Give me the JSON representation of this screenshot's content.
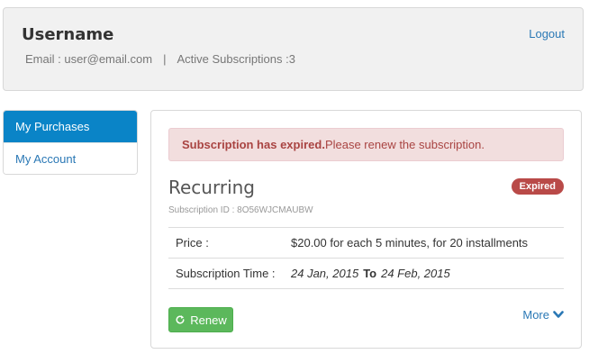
{
  "header": {
    "username": "Username",
    "email_text": "Email : user@email.com",
    "separator": "|",
    "active_subscriptions_text": "Active Subscriptions :3",
    "logout_label": "Logout"
  },
  "sidebar": {
    "items": [
      {
        "label": "My Purchases",
        "active": true
      },
      {
        "label": "My Account",
        "active": false
      }
    ]
  },
  "subscription": {
    "alert_strong": "Subscription has expired.",
    "alert_text": "Please renew the subscription.",
    "title": "Recurring",
    "status_badge": "Expired",
    "id_text": "Subscription ID : 8O56WJCMAUBW",
    "price_label": "Price :",
    "price_value": "$20.00 for each 5 minutes, for 20 installments",
    "time_label": "Subscription Time :",
    "start_date": "24 Jan, 2015",
    "to_label": "To",
    "end_date": "24 Feb, 2015",
    "renew_label": "Renew",
    "more_label": "More"
  },
  "colors": {
    "accent": "#0a84c7",
    "link": "#2a78b5",
    "danger": "#b94a48",
    "success": "#5cb85c"
  },
  "icons": {
    "renew": "refresh-icon",
    "more": "chevron-down-icon"
  }
}
